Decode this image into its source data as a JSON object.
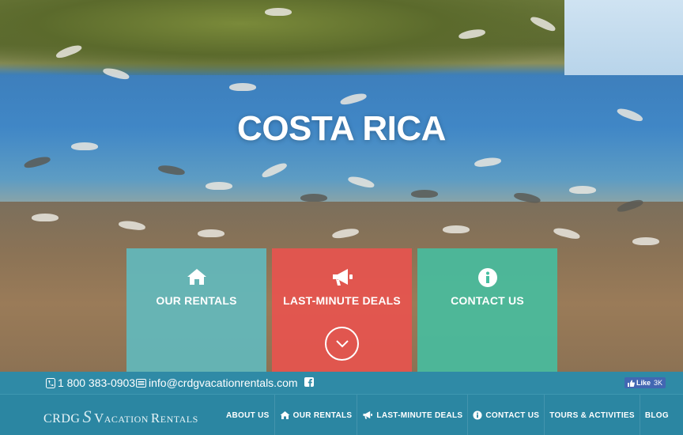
{
  "hero": {
    "title": "COSTA RICA"
  },
  "tiles": {
    "rentals": {
      "label": "OUR RENTALS",
      "icon": "home-icon",
      "color": "#5ebec4"
    },
    "deals": {
      "label": "LAST-MINUTE DEALS",
      "icon": "megaphone-icon",
      "color": "#e7544e"
    },
    "contact": {
      "label": "CONTACT US",
      "icon": "info-icon",
      "color": "#46bea0"
    }
  },
  "contact_bar": {
    "phone": "1 800 383-0903",
    "email": "info@crdgvacationrentals.com",
    "fb_like_label": "Like",
    "fb_like_count": "3K"
  },
  "navbar": {
    "logo": {
      "p1": "CRDG",
      "p2": "V",
      "p3": "ACATION ",
      "p4": "R",
      "p5": "ENTALS",
      "mark": "S"
    },
    "items": [
      {
        "label": "ABOUT US",
        "icon": ""
      },
      {
        "label": "OUR RENTALS",
        "icon": "home-icon"
      },
      {
        "label": "LAST-MINUTE DEALS",
        "icon": "megaphone-icon"
      },
      {
        "label": "CONTACT US",
        "icon": "info-icon"
      },
      {
        "label": "TOURS & ACTIVITIES",
        "icon": ""
      },
      {
        "label": "BLOG",
        "icon": ""
      }
    ]
  },
  "colors": {
    "bar_blue": "#2f8aa6",
    "nav_blue": "#2b86a2"
  }
}
